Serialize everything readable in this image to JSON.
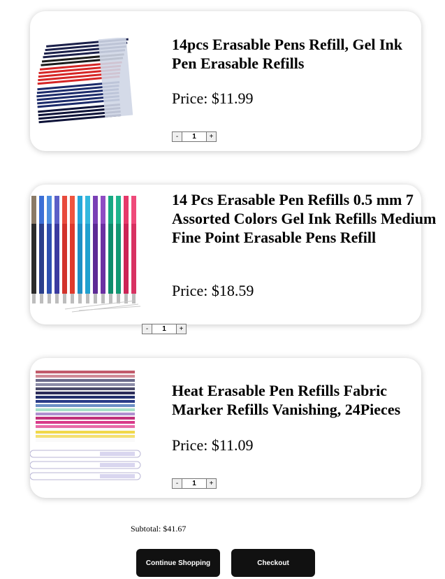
{
  "cart": {
    "items": [
      {
        "title": "14pcs Erasable Pens Refill, Gel Ink Pen Erasable Refills",
        "price_label": "Price: ",
        "price": "$11.99",
        "qty": "1",
        "minus": "-",
        "plus": "+",
        "image_icon": "pen-refill-bundle-image"
      },
      {
        "title": "14 Pcs Erasable Pen Refills 0.5 mm 7 Assorted Colors Gel Ink Refills Medium Fine Point Erasable Pens Refill",
        "price_label": "Price: ",
        "price": "$18.59",
        "qty": "1",
        "minus": "-",
        "plus": "+",
        "image_icon": "colored-pen-refills-image"
      },
      {
        "title": "Heat Erasable Pen Refills Fabric Marker Refills Vanishing, 24Pieces",
        "price_label": "Price: ",
        "price": "$11.09",
        "qty": "1",
        "minus": "-",
        "plus": "+",
        "image_icon": "fabric-marker-refills-image"
      }
    ]
  },
  "summary": {
    "subtotal": "Subtotal: $41.67",
    "continue_label": "Continue Shopping",
    "checkout_label": "Checkout"
  },
  "colors": {
    "button_bg": "#111111",
    "card_bg": "#ffffff"
  }
}
